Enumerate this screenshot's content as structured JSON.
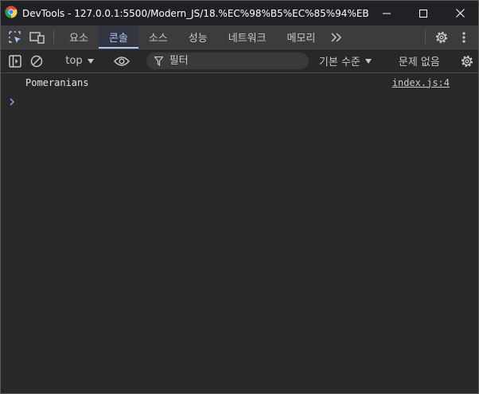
{
  "window": {
    "title": "DevTools - 127.0.0.1:5500/Modern_JS/18.%EC%98%B5%EC%85%94%EB%84%9...",
    "icon": "chrome-icon",
    "controls": [
      "minimize-icon",
      "maximize-icon",
      "close-icon"
    ]
  },
  "tabbar": {
    "tabs": [
      {
        "label": "요소"
      },
      {
        "label": "콘솔",
        "active": true
      },
      {
        "label": "소스"
      },
      {
        "label": "성능"
      },
      {
        "label": "네트워크"
      },
      {
        "label": "메모리"
      }
    ],
    "more_icon": "double-chevron-right-icon",
    "accent": "#a8c7fa"
  },
  "console_toolbar": {
    "context": "top",
    "filter_placeholder": "필터",
    "levels": "기본 수준",
    "issues": "문제 없음"
  },
  "console": {
    "messages": [
      {
        "text": "Pomeranians",
        "source": "index.js:4"
      }
    ],
    "prompt_color": "#7cacf8"
  }
}
